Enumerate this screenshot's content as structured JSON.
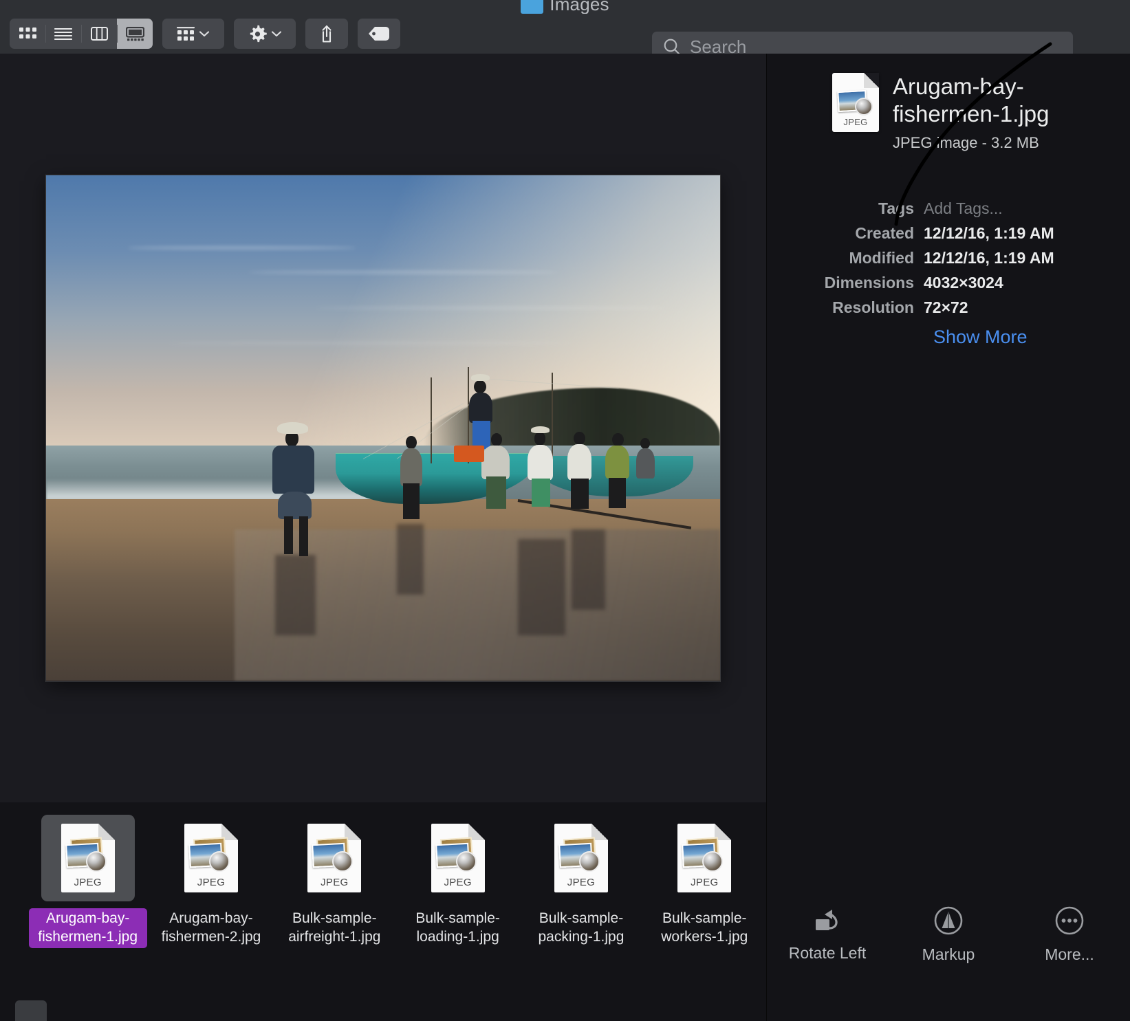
{
  "window": {
    "title": "Images",
    "folder_icon": "folder-icon"
  },
  "toolbar": {
    "view_modes": [
      {
        "name": "icon-view",
        "icon": "grid-icon",
        "active": false
      },
      {
        "name": "list-view",
        "icon": "list-icon",
        "active": false
      },
      {
        "name": "column-view",
        "icon": "columns-icon",
        "active": false
      },
      {
        "name": "gallery-view",
        "icon": "gallery-icon",
        "active": true
      }
    ],
    "group_button": {
      "label": "",
      "icon": "group-grid-icon",
      "chevron": "chevron-down-icon"
    },
    "action_button": {
      "label": "",
      "icon": "gear-icon",
      "chevron": "chevron-down-icon"
    },
    "share_button": {
      "label": "",
      "icon": "share-icon"
    },
    "tag_button": {
      "label": "",
      "icon": "tag-icon"
    }
  },
  "search": {
    "placeholder": "Search",
    "value": "",
    "icon": "search-icon"
  },
  "info": {
    "file_icon": "jpeg-document-icon",
    "file_icon_label": "JPEG",
    "filename": "Arugam-bay-fishermen-1.jpg",
    "kind_and_size": "JPEG image - 3.2 MB",
    "rows": [
      {
        "key": "Tags",
        "value": "Add Tags...",
        "muted": true
      },
      {
        "key": "Created",
        "value": "12/12/16, 1:19 AM",
        "muted": false
      },
      {
        "key": "Modified",
        "value": "12/12/16, 1:19 AM",
        "muted": false
      },
      {
        "key": "Dimensions",
        "value": "4032×3024",
        "muted": false
      },
      {
        "key": "Resolution",
        "value": "72×72",
        "muted": false
      }
    ],
    "show_more": "Show More",
    "show_more_color": "#4a8ff0"
  },
  "thumbnails": [
    {
      "name": "Arugam-bay-fishermen-1.jpg",
      "type_label": "JPEG",
      "selected": true
    },
    {
      "name": "Arugam-bay-fishermen-2.jpg",
      "type_label": "JPEG",
      "selected": false
    },
    {
      "name": "Bulk-sample-airfreight-1.jpg",
      "type_label": "JPEG",
      "selected": false
    },
    {
      "name": "Bulk-sample-loading-1.jpg",
      "type_label": "JPEG",
      "selected": false
    },
    {
      "name": "Bulk-sample-packing-1.jpg",
      "type_label": "JPEG",
      "selected": false
    },
    {
      "name": "Bulk-sample-workers-1.jpg",
      "type_label": "JPEG",
      "selected": false
    }
  ],
  "actions": [
    {
      "label": "Rotate Left",
      "icon": "rotate-left-icon"
    },
    {
      "label": "Markup",
      "icon": "markup-pen-icon"
    },
    {
      "label": "More...",
      "icon": "more-ellipsis-icon"
    }
  ],
  "preview": {
    "alt": "Fishermen with a turquoise outrigger boat on Arugam Bay beach at dusk"
  },
  "colors": {
    "window_bg": "#131317",
    "toolbar_bg": "#2e3034",
    "preview_bg": "#1b1b20",
    "accent_link": "#4a8ff0",
    "selection_purple": "#8c2db5",
    "thumb_selection": "#4d4f53",
    "folder_blue": "#4aa3dd"
  }
}
